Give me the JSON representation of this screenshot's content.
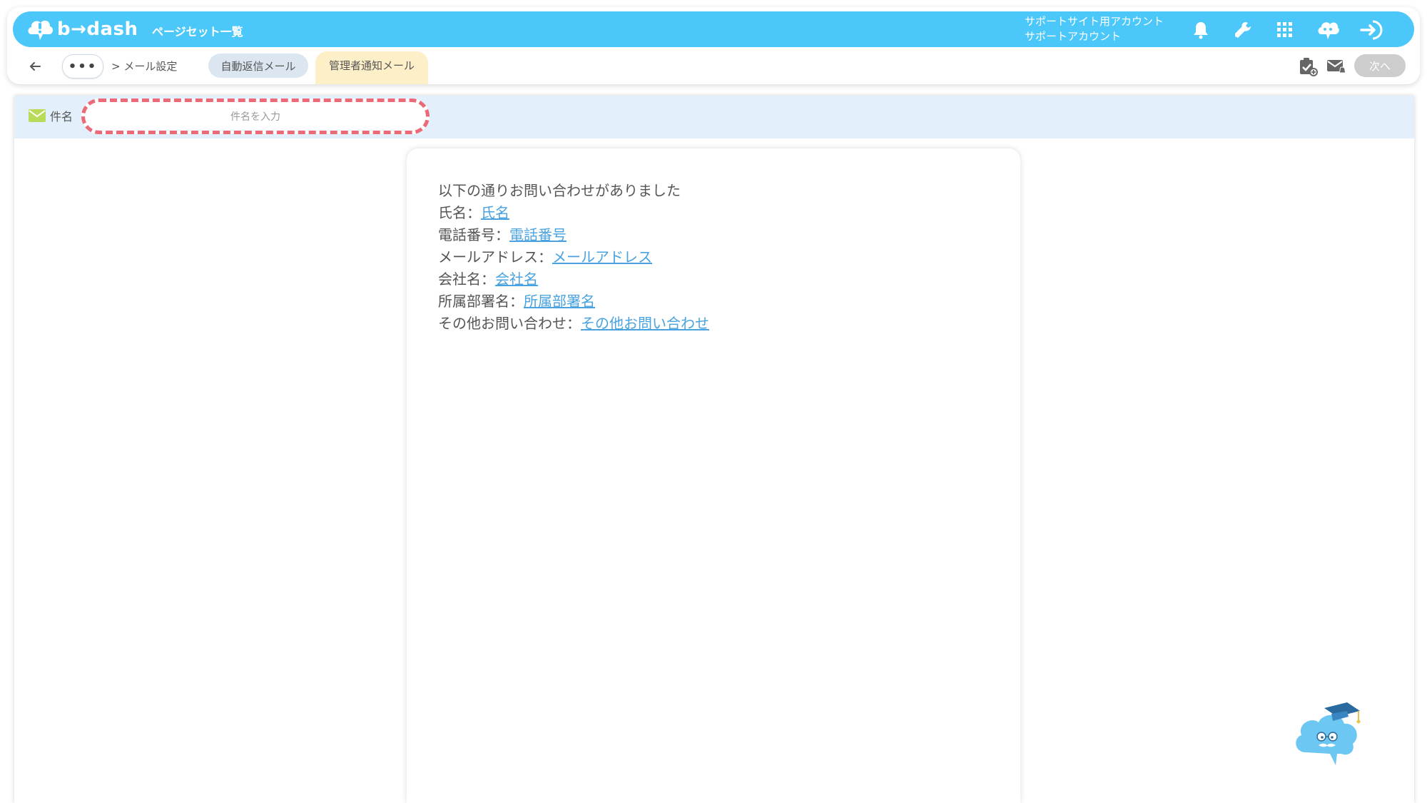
{
  "header": {
    "logo_text": "b→dash",
    "nav_title": "ページセット一覧",
    "account_line1": "サポートサイト用アカウント",
    "account_line2": "サポートアカウント",
    "icons": [
      "bell-icon",
      "wrench-icon",
      "grid-icon",
      "chat-cloud-icon",
      "logout-icon"
    ]
  },
  "subnav": {
    "more": "•••",
    "breadcrumb": "> メール設定",
    "tab_auto_reply": "自動返信メール",
    "tab_admin_notify": "管理者通知メール",
    "next_label": "次へ",
    "icons": [
      "clipboard-check-icon",
      "mail-bell-icon"
    ]
  },
  "subject": {
    "label": "件名",
    "placeholder": "件名を入力"
  },
  "mail_body": {
    "intro": "以下の通りお問い合わせがありました",
    "fields": [
      {
        "label": "氏名：",
        "tag": "氏名"
      },
      {
        "label": "電話番号：",
        "tag": "電話番号"
      },
      {
        "label": "メールアドレス：",
        "tag": "メールアドレス"
      },
      {
        "label": "会社名：",
        "tag": "会社名"
      },
      {
        "label": "所属部署名：",
        "tag": "所属部署名"
      },
      {
        "label": "その他お問い合わせ：",
        "tag": "その他お問い合わせ"
      }
    ]
  },
  "colors": {
    "brand": "#4cc7f9",
    "active_tab": "#fdf0c8",
    "inactive_tab": "#dbe6f1",
    "highlight_border": "#ec6a78",
    "link": "#4aa3df",
    "subject_bar": "#e3effa"
  }
}
